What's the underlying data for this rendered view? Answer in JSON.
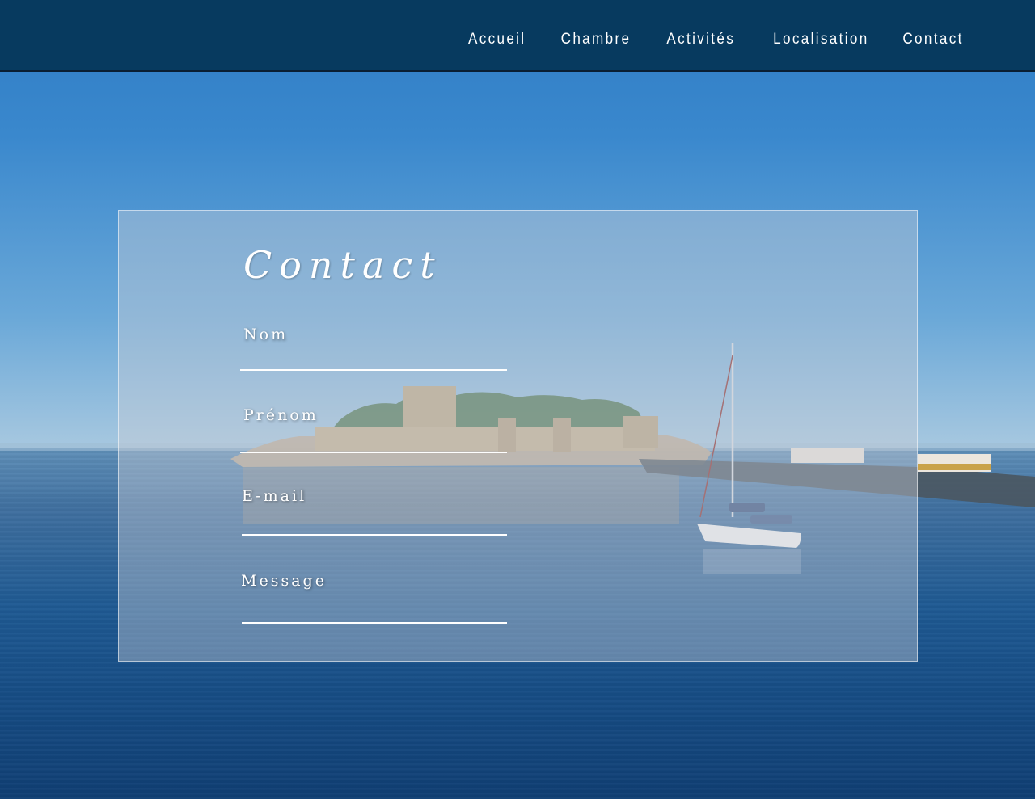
{
  "nav": {
    "items": [
      {
        "label": "Accueil"
      },
      {
        "label": "Chambre"
      },
      {
        "label": "Activités"
      },
      {
        "label": "Localisation"
      },
      {
        "label": "Contact"
      }
    ]
  },
  "contact": {
    "title": "Contact",
    "fields": {
      "nom": {
        "label": "Nom",
        "value": ""
      },
      "prenom": {
        "label": "Prénom",
        "value": ""
      },
      "email": {
        "label": "E-mail",
        "value": ""
      },
      "message": {
        "label": "Message",
        "value": ""
      }
    }
  },
  "colors": {
    "header_bg": "#073a5f",
    "text": "#ffffff",
    "panel_overlay": "rgba(200,205,215,0.42)"
  }
}
